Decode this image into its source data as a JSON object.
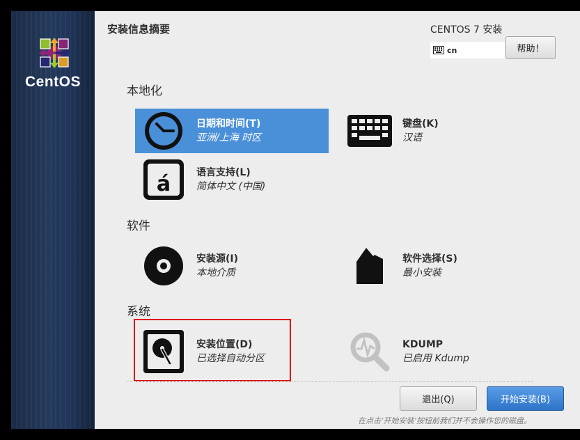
{
  "sidebar": {
    "logo_text": "CentOS"
  },
  "header": {
    "title": "安装信息摘要",
    "product": "CENTOS 7 安装",
    "keyboard_layout": "cn",
    "help_label": "帮助！"
  },
  "sections": {
    "localization": "本地化",
    "software": "软件",
    "system": "系统"
  },
  "spokes": {
    "datetime": {
      "title": "日期和时间(T)",
      "status": "亚洲/上海 时区"
    },
    "keyboard": {
      "title": "键盘(K)",
      "status": "汉语"
    },
    "language": {
      "title": "语言支持(L)",
      "status": "简体中文 (中国)"
    },
    "source": {
      "title": "安装源(I)",
      "status": "本地介质"
    },
    "software_selection": {
      "title": "软件选择(S)",
      "status": "最小安装"
    },
    "destination": {
      "title": "安装位置(D)",
      "status": "已选择自动分区"
    },
    "kdump": {
      "title": "KDUMP",
      "status": "已启用 Kdump"
    }
  },
  "footer": {
    "quit_label": "退出(Q)",
    "begin_label": "开始安装(B)",
    "note": "在点击‘开始安装’按钮前我们并不会操作您的磁盘。"
  },
  "colors": {
    "selected_bg": "#4a90d9",
    "primary_button": "#3a86d8",
    "highlight_border": "#e00000"
  }
}
